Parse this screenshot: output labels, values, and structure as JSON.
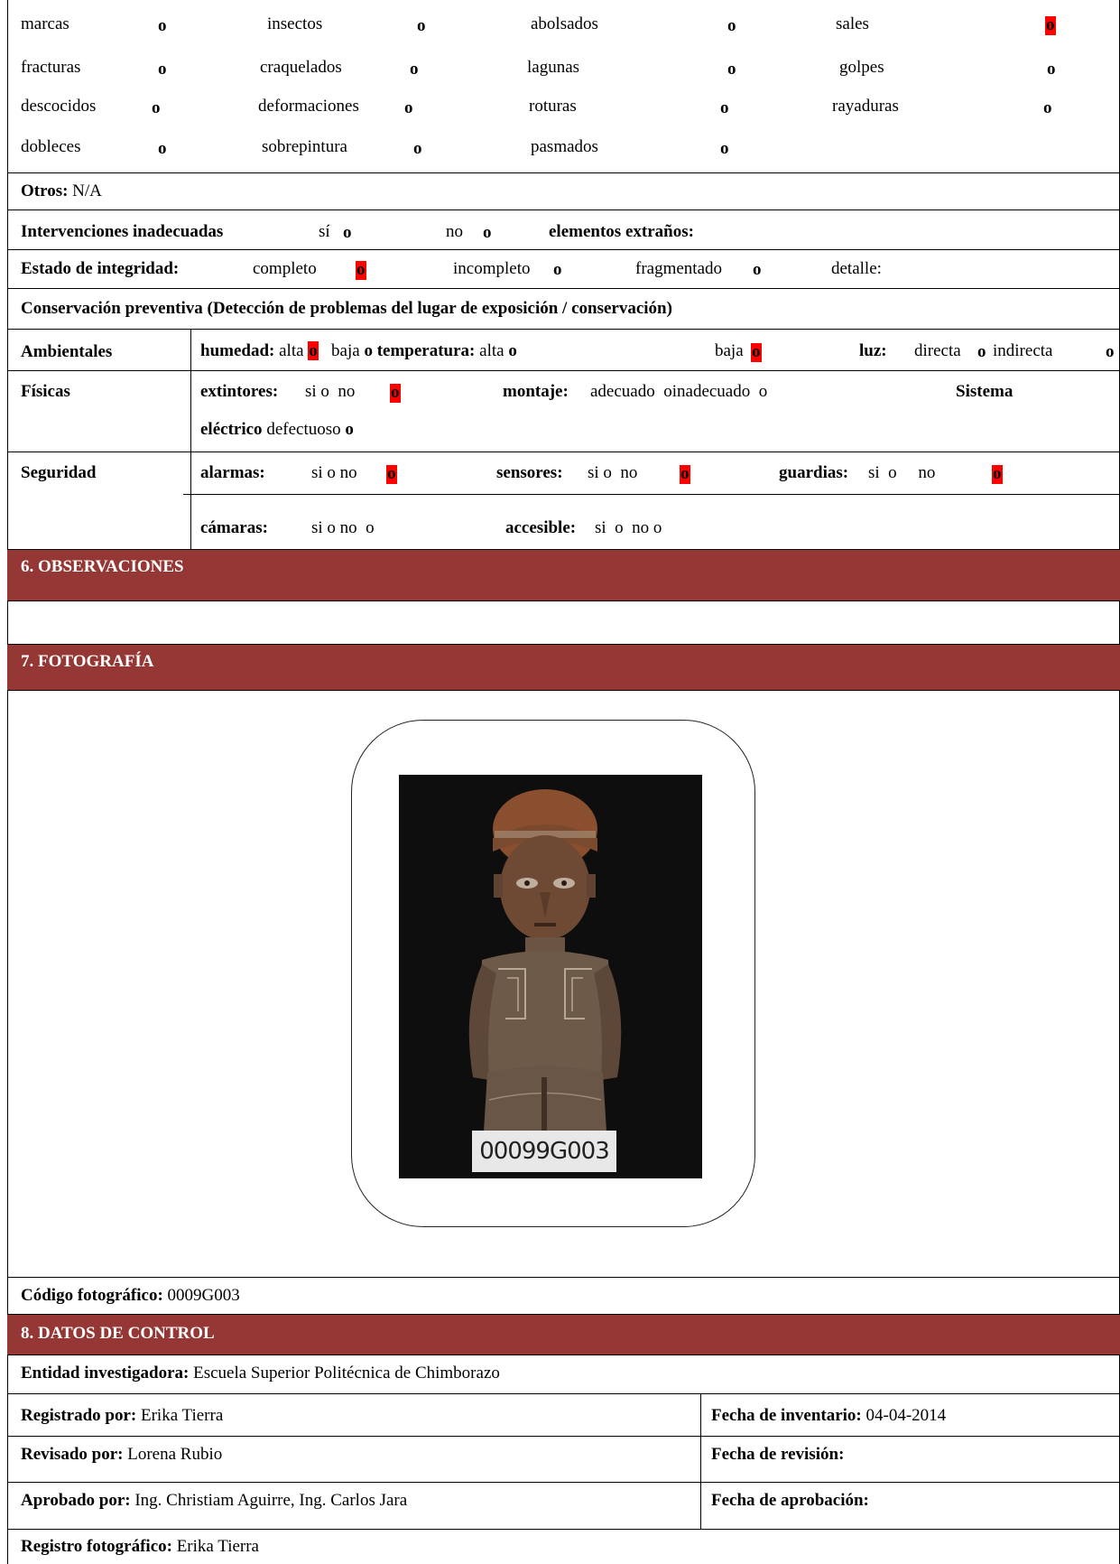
{
  "damage_grid": {
    "rows": [
      [
        {
          "label": "marcas",
          "mark": "o",
          "marked": false
        },
        {
          "label": "insectos",
          "mark": "o",
          "marked": false
        },
        {
          "label": "abolsados",
          "mark": "o",
          "marked": false
        },
        {
          "label": "sales",
          "mark": "o",
          "marked": true
        }
      ],
      [
        {
          "label": "fracturas",
          "mark": "o",
          "marked": false
        },
        {
          "label": "craquelados",
          "mark": "o",
          "marked": false
        },
        {
          "label": "lagunas",
          "mark": "o",
          "marked": false
        },
        {
          "label": "golpes",
          "mark": "o",
          "marked": false
        }
      ],
      [
        {
          "label": "descocidos",
          "mark": "o",
          "marked": false
        },
        {
          "label": "deformaciones",
          "mark": "o",
          "marked": false
        },
        {
          "label": "roturas",
          "mark": "o",
          "marked": false
        },
        {
          "label": "rayaduras",
          "mark": "o",
          "marked": false
        }
      ],
      [
        {
          "label": "dobleces",
          "mark": "o",
          "marked": false
        },
        {
          "label": "sobrepintura",
          "mark": "o",
          "marked": false
        },
        {
          "label": "pasmados",
          "mark": "o",
          "marked": false
        }
      ]
    ]
  },
  "otros": {
    "label": "Otros:",
    "value": "N/A"
  },
  "intervenciones": {
    "label": "Intervenciones inadecuadas",
    "si": "sí",
    "si_mark": "o",
    "no": "no",
    "no_mark": "o",
    "elementos_label": "elementos extraños:"
  },
  "integridad": {
    "label": "Estado de integridad:",
    "completo": "completo",
    "completo_mark": "o",
    "incompleto": "incompleto",
    "incompleto_mark": "o",
    "fragmentado": "fragmentado",
    "fragmentado_mark": "o",
    "detalle": "detalle:"
  },
  "conservacion": {
    "title": "Conservación preventiva (Detección de problemas del lugar de exposición / conservación)",
    "ambientales": {
      "label": "Ambientales",
      "humedad_label": "humedad:",
      "alta": "alta",
      "baja": "baja",
      "temperatura_label": "temperatura:",
      "t_alta": "alta",
      "t_baja": "baja",
      "luz_label": "luz:",
      "directa": "directa",
      "indirecta": "indirecta",
      "mark": "o"
    },
    "fisicas": {
      "label": "Físicas",
      "extintores_label": "extintores:",
      "ext_options": "si o  no",
      "montaje_label": "montaje:",
      "montaje_options": "adecuado  oinadecuado  o",
      "sistema_label": "Sistema",
      "electrico_label": "eléctrico",
      "defectuoso": "defectuoso",
      "mark": "o"
    },
    "seguridad": {
      "label": "Seguridad",
      "alarmas_label": "alarmas:",
      "alarmas_options": "si o no",
      "sensores_label": "sensores:",
      "sensores_options": "si o  no",
      "guardias_label": "guardias:",
      "guardias_options": "si  o     no",
      "camaras_label": "cámaras:",
      "camaras_options": "si o no  o",
      "accesible_label": "accesible:",
      "accesible_options": "si  o  no o",
      "mark": "o"
    }
  },
  "sections": {
    "observaciones": "6. OBSERVACIONES",
    "fotografia": "7. FOTOGRAFÍA",
    "control": "8. DATOS DE CONTROL"
  },
  "photo": {
    "tag_text": "00099G003"
  },
  "codigo_fotografico": {
    "label": "Código fotográfico:",
    "value": "0009G003"
  },
  "control": {
    "entidad": {
      "label": "Entidad investigadora:",
      "value": "Escuela Superior Politécnica de Chimborazo"
    },
    "registrado": {
      "label": "Registrado por:",
      "value": "Erika Tierra"
    },
    "fecha_inventario": {
      "label": "Fecha de inventario:",
      "value": "04-04-2014"
    },
    "revisado": {
      "label": "Revisado por:",
      "value": "Lorena Rubio"
    },
    "fecha_revision": {
      "label": "Fecha de revisión:",
      "value": ""
    },
    "aprobado": {
      "label": "Aprobado por:",
      "value": "Ing. Christiam Aguirre, Ing. Carlos Jara"
    },
    "fecha_aprobacion": {
      "label": "Fecha de aprobación:",
      "value": ""
    },
    "registro_foto": {
      "label": "Registro fotográfico:",
      "value": "Erika Tierra"
    }
  },
  "colors": {
    "section_header": "#953735",
    "check_highlight": "#ff0000"
  }
}
